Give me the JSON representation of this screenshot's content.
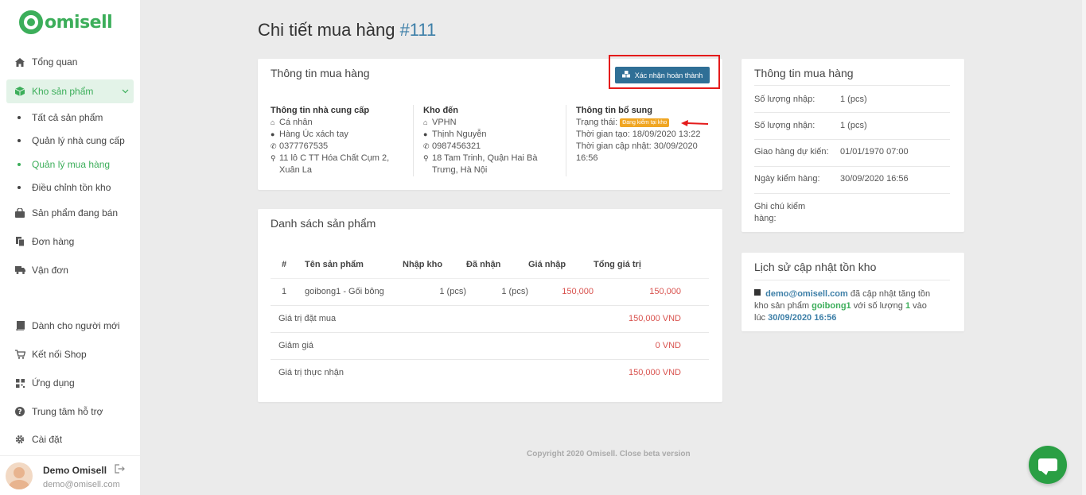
{
  "brand": {
    "name": "omisell"
  },
  "sidebar": {
    "items": [
      {
        "label": "Tổng quan",
        "icon": "home-icon"
      },
      {
        "label": "Kho sản phẩm",
        "icon": "box-icon"
      },
      {
        "label": "Sản phẩm đang bán",
        "icon": "shop-icon"
      },
      {
        "label": "Đơn hàng",
        "icon": "copy-icon"
      },
      {
        "label": "Vận đơn",
        "icon": "truck-icon"
      },
      {
        "label": "Dành cho người mới",
        "icon": "book-icon"
      },
      {
        "label": "Kết nối Shop",
        "icon": "cart-icon"
      },
      {
        "label": "Ứng dụng",
        "icon": "qrcode-icon"
      },
      {
        "label": "Trung tâm hỗ trợ",
        "icon": "question-icon"
      },
      {
        "label": "Cài đặt",
        "icon": "gear-icon"
      }
    ],
    "sub_items": [
      {
        "label": "Tất cả sản phẩm"
      },
      {
        "label": "Quản lý nhà cung cấp"
      },
      {
        "label": "Quản lý mua hàng"
      },
      {
        "label": "Điều chỉnh tồn kho"
      }
    ]
  },
  "user": {
    "name": "Demo Omisell",
    "email": "demo@omisell.com"
  },
  "page": {
    "title": "Chi tiết mua hàng",
    "number": "#111"
  },
  "info_card": {
    "title": "Thông tin mua hàng",
    "confirm_button": "Xác nhận hoàn thành",
    "supplier": {
      "title": "Thông tin nhà cung cấp",
      "type": "Cá nhân",
      "name": "Hàng Úc xách tay",
      "phone": "0377767535",
      "address": "11 lô C TT Hóa Chất Cụm 2, Xuân La"
    },
    "warehouse": {
      "title": "Kho đến",
      "name": "VPHN",
      "contact": "Thịnh Nguyễn",
      "phone": "0987456321",
      "address": "18 Tam Trinh, Quận Hai Bà Trưng, Hà Nội"
    },
    "extra": {
      "title": "Thông tin bổ sung",
      "status_label": "Trạng thái:",
      "status_badge": "Đang kiểm tại kho",
      "created": "Thời gian tạo: 18/09/2020 13:22",
      "updated": "Thời gian cập nhật: 30/09/2020 16:56"
    }
  },
  "products_card": {
    "title": "Danh sách sản phẩm",
    "headers": [
      "#",
      "Tên sản phẩm",
      "Nhập kho",
      "Đã nhận",
      "Giá nhập",
      "Tổng giá trị"
    ],
    "rows": [
      {
        "index": "1",
        "name": "goibong1 - Gối bông",
        "import_qty": "1 (pcs)",
        "received": "1 (pcs)",
        "price": "150,000",
        "total": "150,000"
      }
    ],
    "summary": [
      {
        "label": "Giá trị đặt mua",
        "value": "150,000 VND"
      },
      {
        "label": "Giảm giá",
        "value": "0 VND"
      },
      {
        "label": "Giá trị thực nhận",
        "value": "150,000 VND"
      }
    ]
  },
  "summary_card": {
    "title": "Thông tin mua hàng",
    "rows": [
      {
        "label": "Số lượng nhập:",
        "value": "1 (pcs)"
      },
      {
        "label": "Số lượng nhận:",
        "value": "1 (pcs)"
      },
      {
        "label": "Giao hàng dự kiến:",
        "value": "01/01/1970 07:00"
      },
      {
        "label": "Ngày kiểm hàng:",
        "value": "30/09/2020 16:56"
      },
      {
        "label": "Ghi chú kiểm hàng:",
        "value": ""
      }
    ]
  },
  "history_card": {
    "title": "Lịch sử cập nhật tồn kho",
    "email": "demo@omisell.com",
    "text1": "đã cập nhật tăng tồn kho sản phẩm",
    "product": "goibong1",
    "text2": "với số lượng",
    "qty": "1",
    "text3": "vào lúc",
    "time": "30/09/2020 16:56"
  },
  "footer": {
    "copyright": "Copyright 2020 Omisell. Close beta version"
  },
  "colors": {
    "brand_green": "#3cae5a",
    "primary_blue": "#2f6f96",
    "badge_orange": "#f0a623",
    "price_red": "#d9534f"
  }
}
